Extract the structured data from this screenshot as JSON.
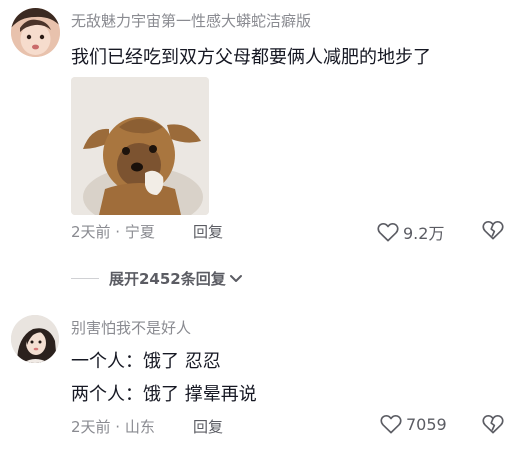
{
  "comments": [
    {
      "username": "无敌魅力宇宙第一性感大蟒蛇洁癖版",
      "lines": [
        "我们已经吃到双方父母都要俩人减肥的地步了"
      ],
      "meta": "2天前 · 宁夏",
      "reply_label": "回复",
      "like_count": "9.2万"
    },
    {
      "username": "别害怕我不是好人",
      "lines": [
        "一个人：饿了 忍忍",
        "两个人：饿了 撑晕再说"
      ],
      "meta": "2天前 · 山东",
      "reply_label": "回复",
      "like_count": "7059"
    }
  ],
  "expand_replies": {
    "label": "展开2452条回复"
  },
  "icons": {
    "like": "heart-outline-icon",
    "dislike": "broken-heart-icon",
    "expand": "chevron-down-icon"
  },
  "colors": {
    "text_primary": "#161823",
    "text_secondary": "#8a8b91",
    "action_text": "#5b5c63"
  }
}
